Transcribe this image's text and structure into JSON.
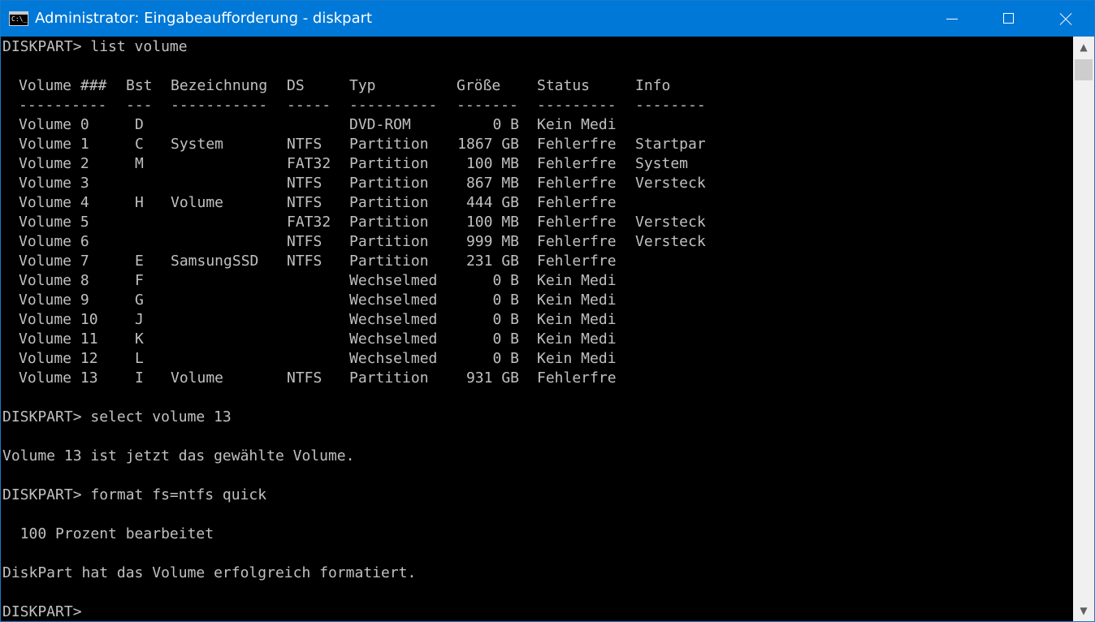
{
  "window": {
    "title": "Administrator: Eingabeaufforderung - diskpart",
    "icon_label": "C:\\_",
    "title_color": "#0078d7",
    "console_bg": "#000000",
    "console_fg": "#c0c0c0"
  },
  "controls": {
    "minimize": "minimize-icon",
    "maximize": "maximize-icon",
    "close": "close-icon"
  },
  "console": {
    "cmd_list": "DISKPART> list volume",
    "headers": {
      "volume": "Volume ###",
      "bst": "Bst",
      "bezeichnung": "Bezeichnung",
      "ds": "DS",
      "typ": "Typ",
      "groesse": "Größe",
      "status": "Status",
      "info": "Info"
    },
    "separators": {
      "volume": "----------",
      "bst": "---",
      "bezeichnung": "-----------",
      "ds": "-----",
      "typ": "----------",
      "groesse": "-------",
      "status": "---------",
      "info": "--------"
    },
    "volumes": [
      {
        "volume": "Volume 0",
        "bst": "D",
        "bezeichnung": "",
        "ds": "",
        "typ": "DVD-ROM",
        "groesse": "0 B",
        "status": "Kein Medi",
        "info": ""
      },
      {
        "volume": "Volume 1",
        "bst": "C",
        "bezeichnung": "System",
        "ds": "NTFS",
        "typ": "Partition",
        "groesse": "1867 GB",
        "status": "Fehlerfre",
        "info": "Startpar"
      },
      {
        "volume": "Volume 2",
        "bst": "M",
        "bezeichnung": "",
        "ds": "FAT32",
        "typ": "Partition",
        "groesse": "100 MB",
        "status": "Fehlerfre",
        "info": "System"
      },
      {
        "volume": "Volume 3",
        "bst": "",
        "bezeichnung": "",
        "ds": "NTFS",
        "typ": "Partition",
        "groesse": "867 MB",
        "status": "Fehlerfre",
        "info": "Versteck"
      },
      {
        "volume": "Volume 4",
        "bst": "H",
        "bezeichnung": "Volume",
        "ds": "NTFS",
        "typ": "Partition",
        "groesse": "444 GB",
        "status": "Fehlerfre",
        "info": ""
      },
      {
        "volume": "Volume 5",
        "bst": "",
        "bezeichnung": "",
        "ds": "FAT32",
        "typ": "Partition",
        "groesse": "100 MB",
        "status": "Fehlerfre",
        "info": "Versteck"
      },
      {
        "volume": "Volume 6",
        "bst": "",
        "bezeichnung": "",
        "ds": "NTFS",
        "typ": "Partition",
        "groesse": "999 MB",
        "status": "Fehlerfre",
        "info": "Versteck"
      },
      {
        "volume": "Volume 7",
        "bst": "E",
        "bezeichnung": "SamsungSSD",
        "ds": "NTFS",
        "typ": "Partition",
        "groesse": "231 GB",
        "status": "Fehlerfre",
        "info": ""
      },
      {
        "volume": "Volume 8",
        "bst": "F",
        "bezeichnung": "",
        "ds": "",
        "typ": "Wechselmed",
        "groesse": "0 B",
        "status": "Kein Medi",
        "info": ""
      },
      {
        "volume": "Volume 9",
        "bst": "G",
        "bezeichnung": "",
        "ds": "",
        "typ": "Wechselmed",
        "groesse": "0 B",
        "status": "Kein Medi",
        "info": ""
      },
      {
        "volume": "Volume 10",
        "bst": "J",
        "bezeichnung": "",
        "ds": "",
        "typ": "Wechselmed",
        "groesse": "0 B",
        "status": "Kein Medi",
        "info": ""
      },
      {
        "volume": "Volume 11",
        "bst": "K",
        "bezeichnung": "",
        "ds": "",
        "typ": "Wechselmed",
        "groesse": "0 B",
        "status": "Kein Medi",
        "info": ""
      },
      {
        "volume": "Volume 12",
        "bst": "L",
        "bezeichnung": "",
        "ds": "",
        "typ": "Wechselmed",
        "groesse": "0 B",
        "status": "Kein Medi",
        "info": ""
      },
      {
        "volume": "Volume 13",
        "bst": "I",
        "bezeichnung": "Volume",
        "ds": "NTFS",
        "typ": "Partition",
        "groesse": "931 GB",
        "status": "Fehlerfre",
        "info": ""
      }
    ],
    "cmd_select": "DISKPART> select volume 13",
    "msg_selected": "Volume 13 ist jetzt das gewählte Volume.",
    "cmd_format": "DISKPART> format fs=ntfs quick",
    "msg_progress": "  100 Prozent bearbeitet",
    "msg_success": "DiskPart hat das Volume erfolgreich formatiert.",
    "prompt": "DISKPART> "
  },
  "scrollbar": {
    "up_icon": "scroll-up-arrow-icon",
    "down_icon": "scroll-down-arrow-icon"
  }
}
